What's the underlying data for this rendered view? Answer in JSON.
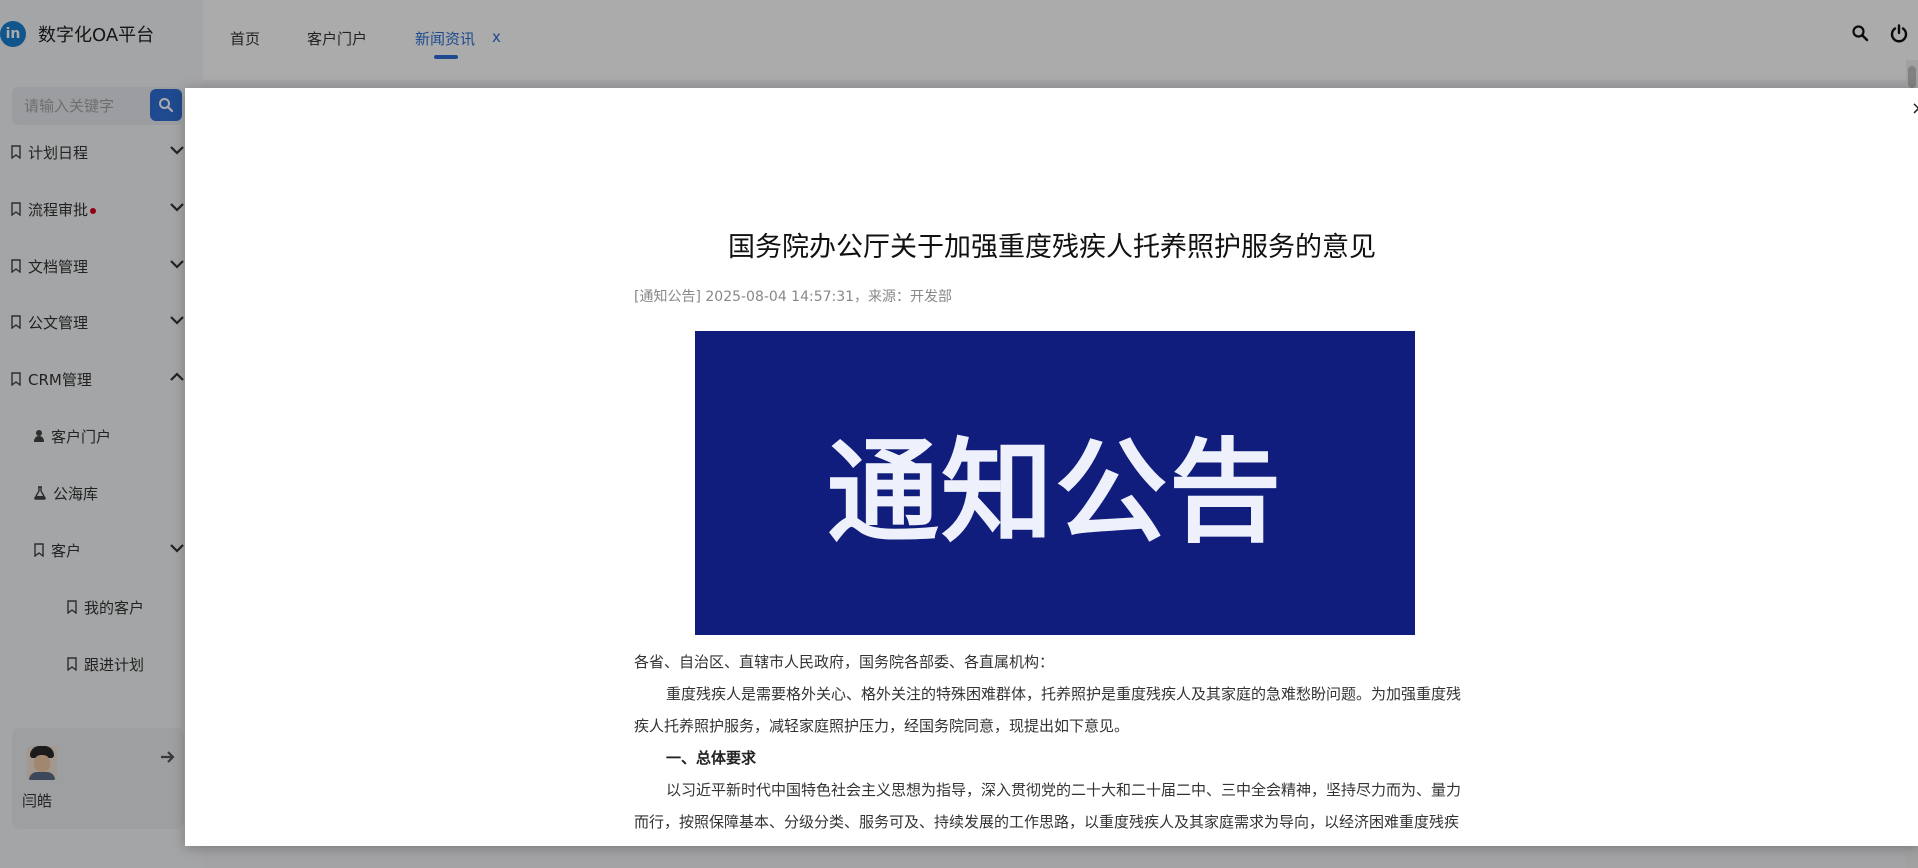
{
  "app": {
    "logo_text": "in",
    "name": "数字化OA平台"
  },
  "sidebar": {
    "search_placeholder": "请输入关键字",
    "menu": [
      {
        "label": "计划日程",
        "expanded": false
      },
      {
        "label": "流程审批",
        "expanded": false,
        "has_dot": true
      },
      {
        "label": "文档管理",
        "expanded": false
      },
      {
        "label": "公文管理",
        "expanded": false
      },
      {
        "label": "CRM管理",
        "expanded": true
      }
    ],
    "crm_children": [
      {
        "label": "客户门户",
        "icon": "user-tie-icon"
      },
      {
        "label": "公海库",
        "icon": "flask-icon"
      },
      {
        "label": "客户",
        "icon": "bookmark-icon",
        "expanded": false
      }
    ],
    "customer_children": [
      {
        "label": "我的客户"
      },
      {
        "label": "跟进计划"
      }
    ],
    "user": {
      "name": "闫皓"
    }
  },
  "tabs": [
    {
      "label": "首页",
      "active": false
    },
    {
      "label": "客户门户",
      "active": false
    },
    {
      "label": "新闻资讯",
      "active": true,
      "closable": true
    }
  ],
  "tab_close_label": "x",
  "modal": {
    "close_label": "×",
    "title": "国务院办公厅关于加强重度残疾人托养照护服务的意见",
    "meta": "[通知公告] 2025-08-04 14:57:31，来源：开发部",
    "banner_text": "通知公告",
    "paragraphs": [
      "各省、自治区、直辖市人民政府，国务院各部委、各直属机构：",
      "重度残疾人是需要格外关心、格外关注的特殊困难群体，托养照护是重度残疾人及其家庭的急难愁盼问题。为加强重度残疾人托养照护服务，减轻家庭照护压力，经国务院同意，现提出如下意见。",
      "一、总体要求",
      "以习近平新时代中国特色社会主义思想为指导，深入贯彻党的二十大和二十届二中、三中全会精神，坚持尽力而为、量力而行，按照保障基本、分级分类、服务可及、持续发展的工作思路，以重度残疾人及其家庭需求为导向，以经济困难重度残疾人托养照护服务为重点，加强资源统筹和政策衔接，完善服务设施，健全体系，推动托养照护服务扩容"
    ]
  },
  "colors": {
    "accent": "#2f6fd6",
    "banner_bg": "#101d7c",
    "dot": "#d9001b"
  }
}
